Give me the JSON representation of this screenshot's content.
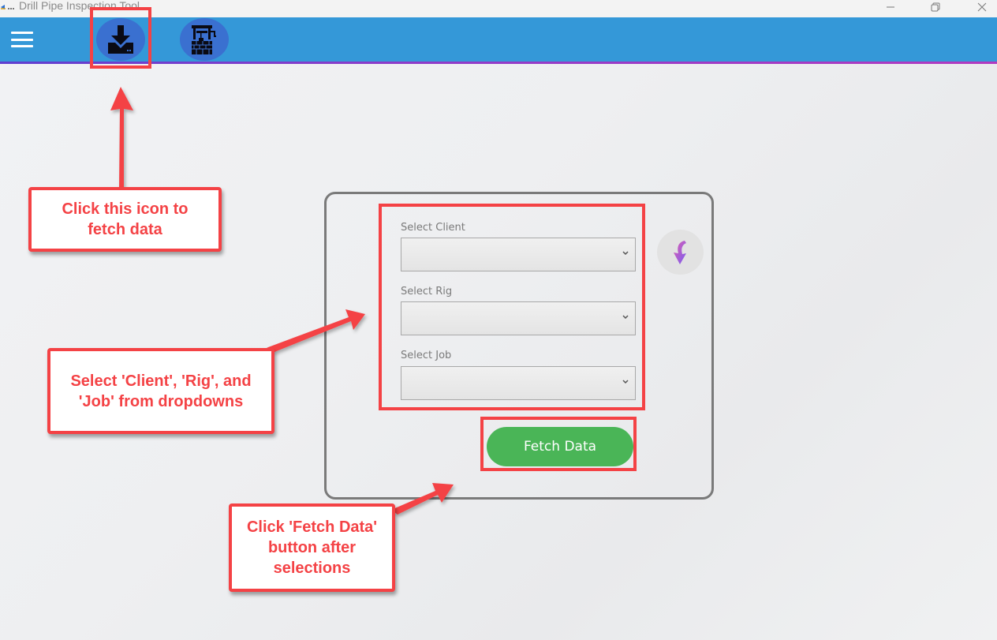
{
  "window": {
    "title": "Drill Pipe Inspection Tool",
    "controls": {
      "minimize": "minimize",
      "maximize": "restore",
      "close": "close"
    }
  },
  "header": {
    "menu_icon": "hamburger-menu-icon",
    "toolbar_icons": [
      {
        "name": "download-data-icon"
      },
      {
        "name": "oil-well-icon"
      }
    ],
    "accent_color": "#3498d8",
    "underline_gradient": [
      "#5f3fd0",
      "#b23ac0"
    ]
  },
  "form": {
    "fields": [
      {
        "label": "Select Client",
        "value": ""
      },
      {
        "label": "Select Rig",
        "value": ""
      },
      {
        "label": "Select Job",
        "value": ""
      }
    ],
    "refresh_icon": "refresh-arrow-icon",
    "fetch_button": "Fetch Data",
    "fetch_button_color": "#4ab557"
  },
  "annotations": {
    "color": "#f44245",
    "callouts": [
      {
        "text": "Click this icon to\nfetch data"
      },
      {
        "text": "Select 'Client', 'Rig', and\n'Job' from dropdowns"
      },
      {
        "text": "Click 'Fetch Data'\nbutton after\nselections"
      }
    ]
  }
}
